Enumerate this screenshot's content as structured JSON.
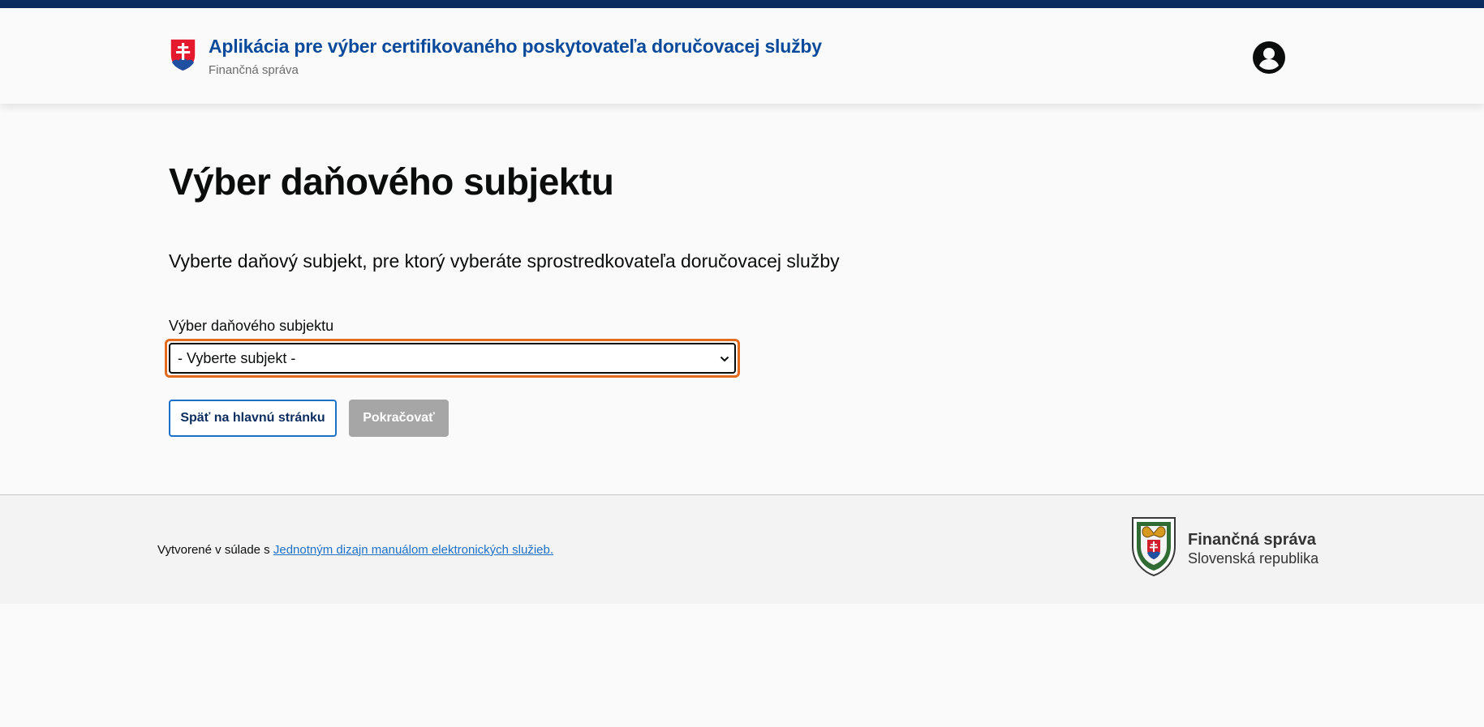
{
  "header": {
    "app_title": "Aplikácia pre výber certifikovaného poskytovateľa doručovacej služby",
    "app_subtitle": "Finančná správa",
    "logo_icon": "slovak-coat-of-arms-icon",
    "user_icon": "user-account-icon"
  },
  "main": {
    "page_title": "Výber daňového subjektu",
    "lead_text": "Vyberte daňový subjekt, pre ktorý vyberáte sprostredkovateľa doručovacej služby",
    "select_label": "Výber daňového subjektu",
    "select_value": "- Vyberte subjekt -",
    "back_button": "Späť na hlavnú stránku",
    "continue_button": "Pokračovať"
  },
  "footer": {
    "created_prefix": "Vytvorené v súlade s ",
    "manual_link": "Jednotným dizajn manuálom elektronických služieb.",
    "org_name": "Finančná správa",
    "org_country": "Slovenská republika",
    "emblem_icon": "financial-administration-emblem-icon"
  },
  "colors": {
    "top_stripe": "#0b2c5e",
    "title_blue": "#0b4a9b",
    "focus_orange": "#e36b1e",
    "link_blue": "#1d70c8",
    "disabled_gray": "#a6a6a6"
  }
}
